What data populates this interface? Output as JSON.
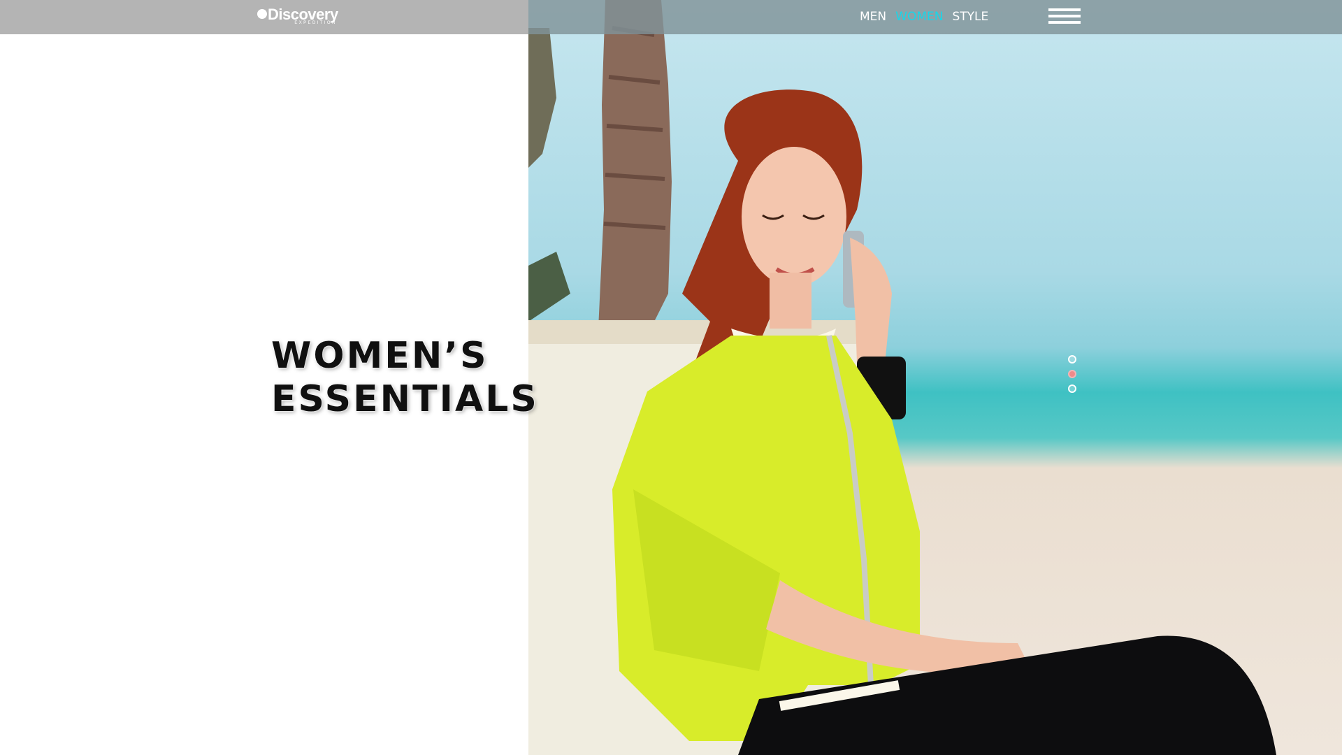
{
  "brand": {
    "logo_text": "Discovery",
    "logo_subtext": "EXPEDITION"
  },
  "nav": {
    "items": [
      {
        "label": "MEN",
        "active": false
      },
      {
        "label": "WOMEN",
        "active": true
      },
      {
        "label": "STYLE",
        "active": false
      }
    ],
    "active_color": "#19d6e8",
    "menu_icon": "hamburger-icon"
  },
  "hero": {
    "headline_line1": "WOMEN’S",
    "headline_line2": "ESSENTIALS",
    "image_description_icon": "hero-photo"
  },
  "slider": {
    "count": 3,
    "active_index": 1,
    "active_color": "#f08a8a"
  },
  "colors": {
    "topbar_left": "#b4b4b4",
    "topbar_right": "#809298",
    "jacket": "#d8ec2a"
  }
}
